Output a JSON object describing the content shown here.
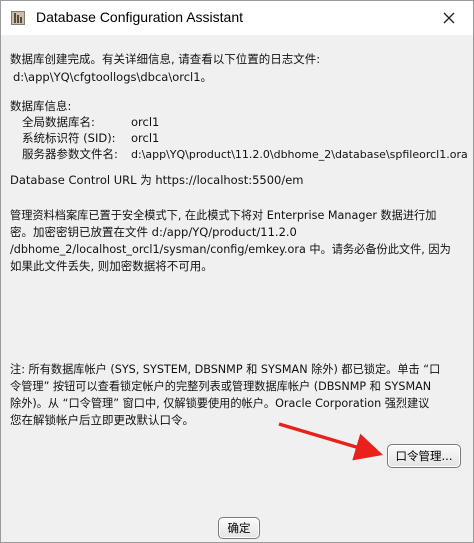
{
  "window": {
    "title": "Database Configuration Assistant"
  },
  "summary": {
    "created_line1": "数据库创建完成。有关详细信息, 请查看以下位置的日志文件:",
    "created_line2": "d:\\app\\YQ\\cfgtoollogs\\dbca\\orcl1。",
    "info_heading": "数据库信息:",
    "global_db_name_label": "全局数据库名:",
    "global_db_name_value": "orcl1",
    "sid_label": "系统标识符 (SID):",
    "sid_value": "orcl1",
    "spfile_label": "服务器参数文件名:",
    "spfile_value": "d:\\app\\YQ\\product\\11.2.0\\dbhome_2\\database\\spfileorcl1.ora",
    "control_url": "Database Control URL 为 https://localhost:5500/em",
    "repo_line1": "管理资料档案库已置于安全模式下, 在此模式下将对 Enterprise Manager 数据进行加",
    "repo_line2": "密。加密密钥已放置在文件 d:/app/YQ/product/11.2.0",
    "repo_line3": "/dbhome_2/localhost_orcl1/sysman/config/emkey.ora 中。请务必备份此文件, 因为",
    "repo_line4": "如果此文件丢失, 则加密数据将不可用。",
    "note_line1": "注: 所有数据库帐户 (SYS, SYSTEM, DBSNMP 和 SYSMAN 除外) 都已锁定。单击 “口",
    "note_line2": "令管理” 按钮可以查看锁定帐户的完整列表或管理数据库帐户 (DBSNMP 和 SYSMAN",
    "note_line3": "除外)。从 “口令管理” 窗口中, 仅解锁要使用的帐户。Oracle Corporation 强烈建议",
    "note_line4": "您在解锁帐户后立即更改默认口令。"
  },
  "buttons": {
    "password_mgmt": "口令管理...",
    "ok": "确定"
  },
  "colors": {
    "annotation_arrow": "#e8211b"
  }
}
